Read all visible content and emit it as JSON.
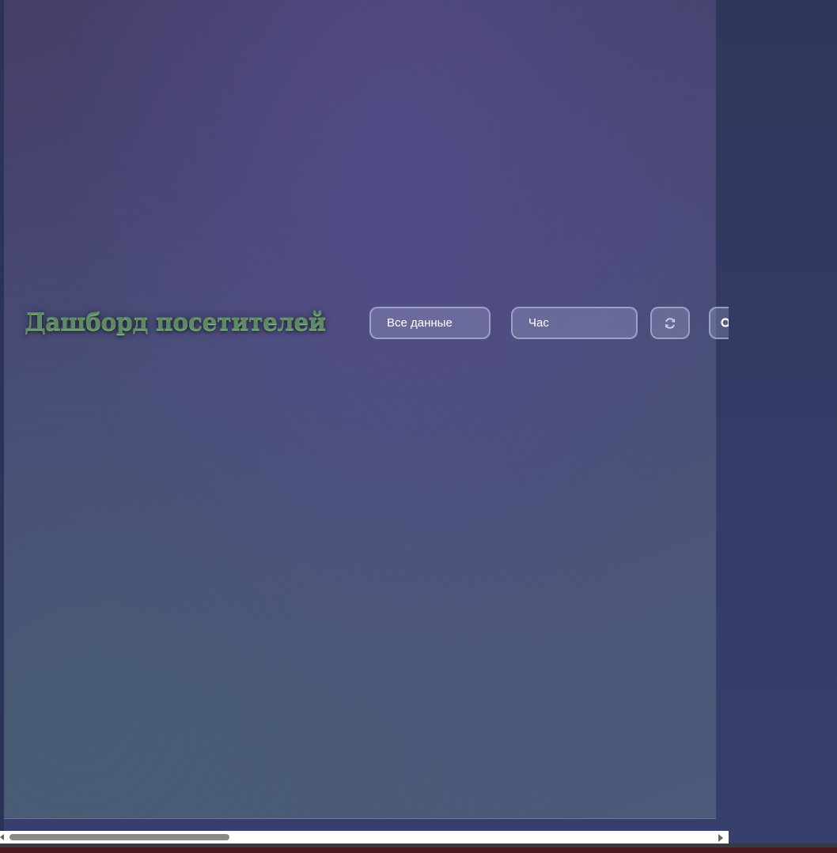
{
  "dashboard": {
    "title": "Дашборд посетителей",
    "scope_select": {
      "value": "Все данные"
    },
    "period_select": {
      "value": "Час"
    },
    "refresh_button": {
      "icon": "refresh-icon"
    },
    "clipped_button": {
      "icon": "search-icon"
    }
  },
  "scrollbar": {
    "position": 0.0
  },
  "colors": {
    "title_green": "#5d8a64",
    "panel_base": "#4a4a7a",
    "background": "#323a64"
  }
}
